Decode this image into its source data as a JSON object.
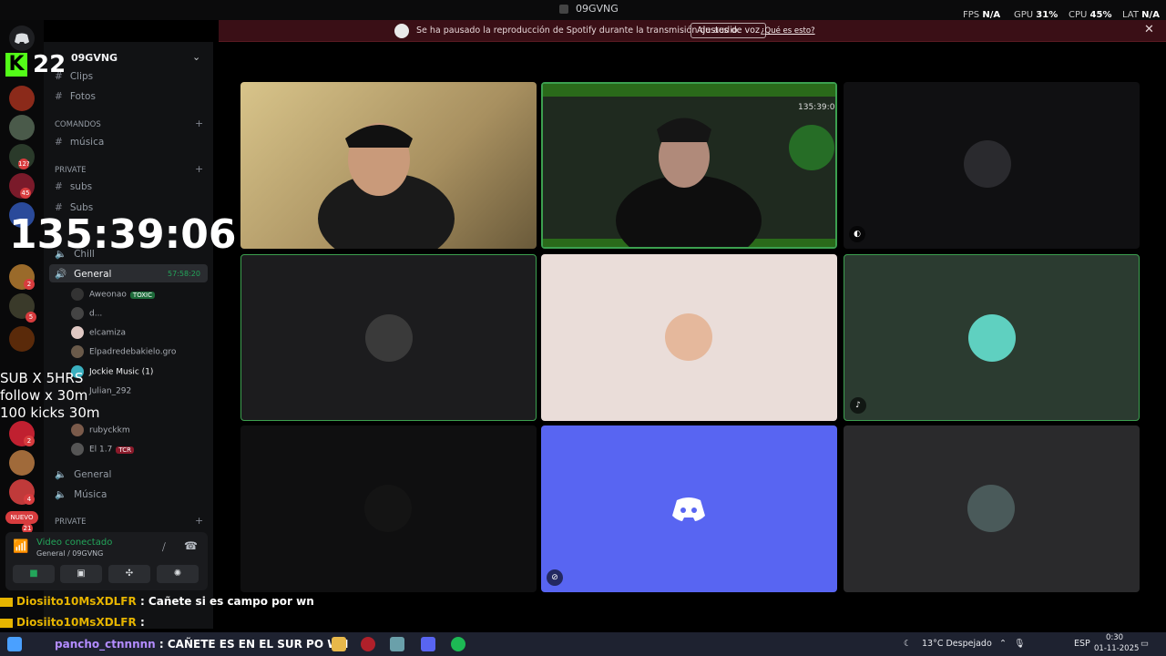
{
  "window": {
    "title": "09GVNG"
  },
  "perf": {
    "fps_label": "FPS",
    "fps": "N/A",
    "gpu_label": "GPU",
    "gpu": "31%",
    "cpu_label": "CPU",
    "cpu": "45%",
    "lat_label": "LAT",
    "lat": "N/A"
  },
  "notice": {
    "message": "Se ha pausado la reproducción de Spotify durante la transmisión de audio.",
    "button": "Ajustes de voz",
    "link": "¿Qué es esto?",
    "close": "✕"
  },
  "server": {
    "name": "09GVNG"
  },
  "channels": {
    "clips": "Clips",
    "fotos": "Fotos",
    "cat_comandos": "COMANDOS",
    "musica_text": "música",
    "cat_private": "Private",
    "subs": "subs",
    "subs_voice": "Subs",
    "chill": "Chill",
    "general_voice": "General",
    "general_timer": "57:58:20",
    "general2": "General",
    "musica_voice": "Música",
    "cat_private2": "Private"
  },
  "members": [
    {
      "name": "Aweonao",
      "tag": "TOXIC"
    },
    {
      "name": "d..."
    },
    {
      "name": "elcamiza"
    },
    {
      "name": "Elpadredebakielo.gro"
    },
    {
      "name": "Jockie Music (1)"
    },
    {
      "name": "Julian_292"
    },
    {
      "name": "rubyckkm"
    },
    {
      "name": "El 1.7",
      "tag": "TCR"
    }
  ],
  "voice_panel": {
    "status": "Video conectado",
    "channel": "General / 09GVNG"
  },
  "overlay": {
    "kick_count": "22",
    "timer": "135:39:06",
    "goal1": "SUB X 5HRS",
    "goal2": "follow x 30m",
    "goal3": "100 kicks 30m",
    "rail_new": "NUEVO"
  },
  "rail_badges": [
    "12?",
    "45",
    "2",
    "5",
    "2",
    "4",
    "21"
  ],
  "chat": [
    {
      "user": "Diosiito10MsXDLFR",
      "message": ": Cañete si es campo por wn"
    },
    {
      "user": "Diosiito10MsXDLFR",
      "message": ":"
    },
    {
      "user": "pancho_ctnnnnn",
      "message": ": CAÑETE ES EN EL SUR PO WN"
    }
  ],
  "taskbar": {
    "weather": "13°C  Despejado",
    "lang": "ESP",
    "time": "0:30",
    "date": "01-11-2025"
  },
  "colors": {
    "speaking": "#3ca04f",
    "discord_blurple": "#5865f2",
    "tile_pink": "#eaddd9",
    "tile_green": "#2b3b30",
    "notice_bg": "#3a0f16"
  }
}
